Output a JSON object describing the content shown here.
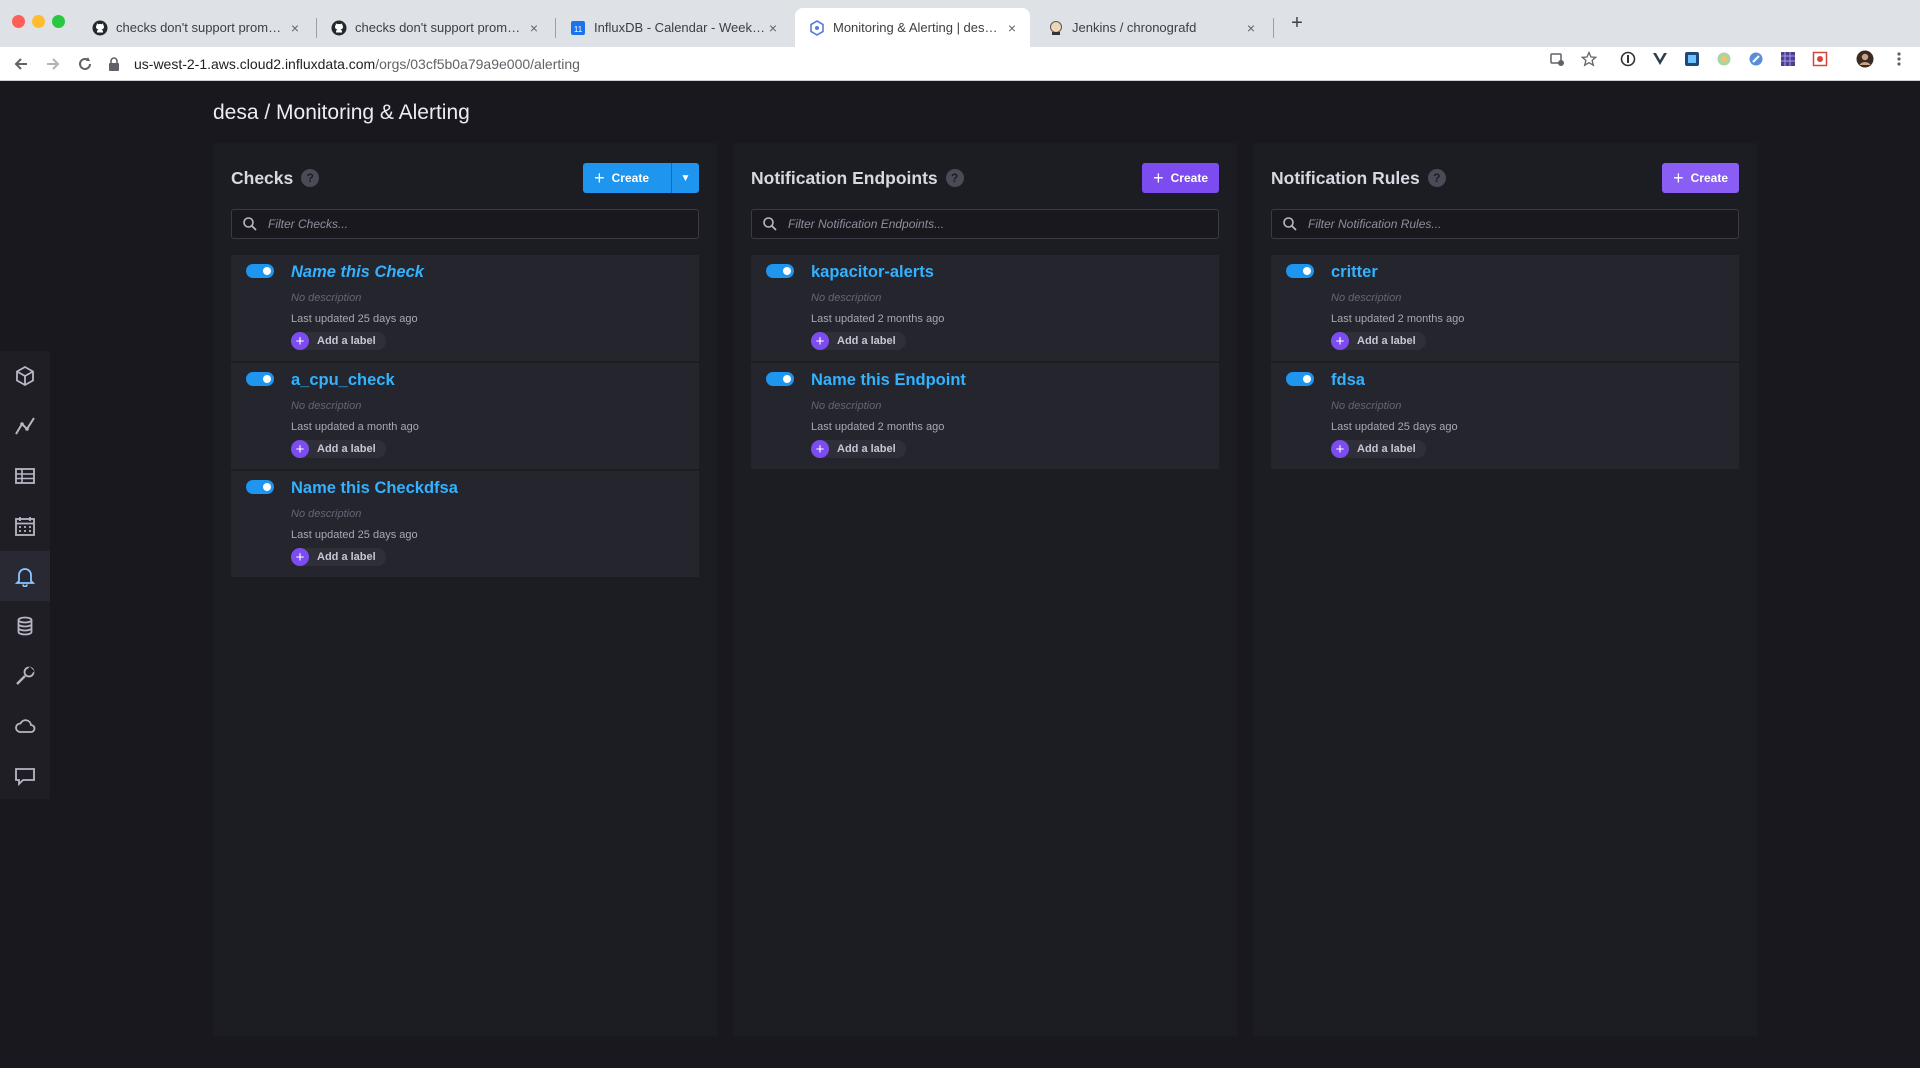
{
  "browser": {
    "tabs": [
      {
        "title": "checks don't support prometheus",
        "icon": "github-icon",
        "active": false
      },
      {
        "title": "checks don't support prometheus",
        "icon": "github-icon",
        "active": false
      },
      {
        "title": "InfluxDB - Calendar - Week of N",
        "icon": "calendar-icon",
        "active": false
      },
      {
        "title": "Monitoring & Alerting | desa | Inf",
        "icon": "influx-icon",
        "active": true
      },
      {
        "title": "Jenkins / chronografd",
        "icon": "jenkins-icon",
        "active": false
      }
    ],
    "url_host": "us-west-2-1.aws.cloud2.influxdata.com",
    "url_path": "/orgs/03cf5b0a79a9e000/alerting"
  },
  "page": {
    "title": "desa / Monitoring & Alerting"
  },
  "nav": {
    "items": [
      {
        "name": "data-explorer",
        "icon": "cube-icon"
      },
      {
        "name": "graphs",
        "icon": "graph-icon"
      },
      {
        "name": "dashboards",
        "icon": "grid-icon"
      },
      {
        "name": "tasks",
        "icon": "calendar-icon"
      },
      {
        "name": "alerting",
        "icon": "bell-icon",
        "active": true
      },
      {
        "name": "data",
        "icon": "database-icon"
      },
      {
        "name": "settings",
        "icon": "wrench-icon"
      },
      {
        "name": "cloud",
        "icon": "cloud-icon"
      },
      {
        "name": "feedback",
        "icon": "chat-icon"
      }
    ]
  },
  "columns": {
    "checks": {
      "title": "Checks",
      "help": "?",
      "create_label": "Create",
      "filter_placeholder": "Filter Checks...",
      "cards": [
        {
          "name": "Name this Check",
          "italic": true,
          "description": "No description",
          "updated": "Last updated 25 days ago",
          "label_btn": "Add a label"
        },
        {
          "name": "a_cpu_check",
          "italic": false,
          "description": "No description",
          "updated": "Last updated a month ago",
          "label_btn": "Add a label"
        },
        {
          "name": "Name this Checkdfsa",
          "italic": false,
          "description": "No description",
          "updated": "Last updated 25 days ago",
          "label_btn": "Add a label"
        }
      ]
    },
    "endpoints": {
      "title": "Notification Endpoints",
      "help": "?",
      "create_label": "Create",
      "filter_placeholder": "Filter Notification Endpoints...",
      "cards": [
        {
          "name": "kapacitor-alerts",
          "description": "No description",
          "updated": "Last updated 2 months ago",
          "label_btn": "Add a label"
        },
        {
          "name": "Name this Endpoint",
          "description": "No description",
          "updated": "Last updated 2 months ago",
          "label_btn": "Add a label"
        }
      ]
    },
    "rules": {
      "title": "Notification Rules",
      "help": "?",
      "create_label": "Create",
      "filter_placeholder": "Filter Notification Rules...",
      "cards": [
        {
          "name": "critter",
          "description": "No description",
          "updated": "Last updated 2 months ago",
          "label_btn": "Add a label"
        },
        {
          "name": "fdsa",
          "description": "No description",
          "updated": "Last updated 25 days ago",
          "label_btn": "Add a label"
        }
      ]
    }
  },
  "colors": {
    "accent_blue": "#1e95ef",
    "accent_purple": "#7c4cf0",
    "link_blue": "#32b2ff",
    "background": "#18181e"
  }
}
